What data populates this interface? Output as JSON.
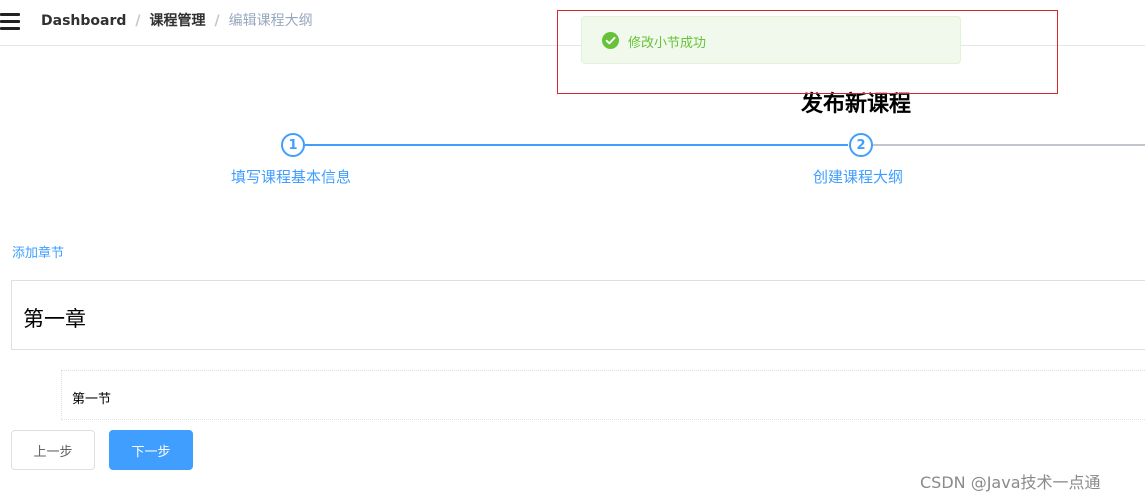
{
  "navbar": {
    "breadcrumb": [
      "Dashboard",
      "课程管理",
      "编辑课程大纲"
    ],
    "separator": "/"
  },
  "page": {
    "title": "发布新课程"
  },
  "steps": [
    {
      "number": "1",
      "title": "填写课程基本信息",
      "status": "finished"
    },
    {
      "number": "2",
      "title": "创建课程大纲",
      "status": "active"
    }
  ],
  "outline": {
    "add_chapter_label": "添加章节",
    "chapters": [
      {
        "title": "第一章",
        "sections": [
          {
            "title": "第一节"
          }
        ]
      }
    ]
  },
  "buttons": {
    "prev_label": "上一步",
    "next_label": "下一步"
  },
  "toast": {
    "type": "success",
    "message": "修改小节成功"
  },
  "watermark": "CSDN @Java技术一点通",
  "colors": {
    "primary": "#409eff",
    "success": "#67c23a",
    "success_bg": "#f0f9eb",
    "highlight_frame": "#d9262c"
  }
}
